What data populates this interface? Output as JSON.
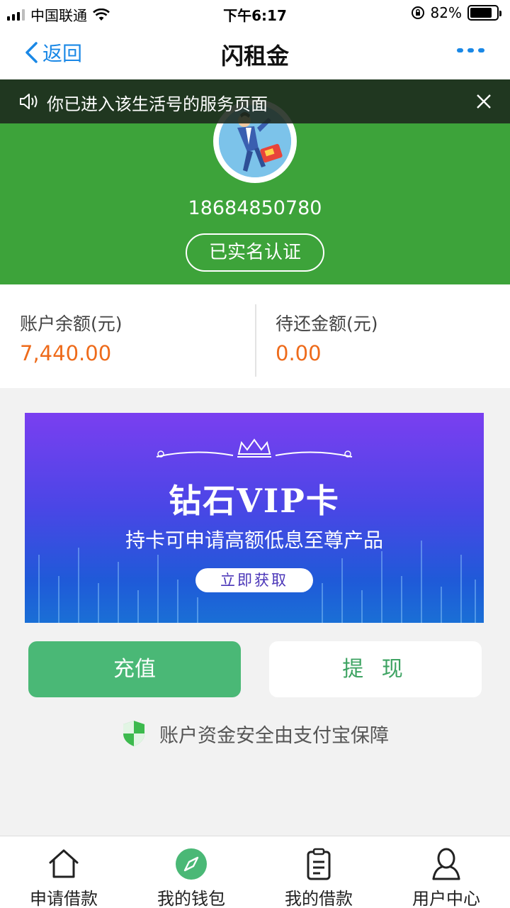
{
  "status_bar": {
    "carrier": "中国联通",
    "time": "下午6:17",
    "battery": "82%",
    "battery_level": 0.82
  },
  "nav": {
    "back_label": "返回",
    "title": "闪租金"
  },
  "notice": {
    "text": "你已进入该生活号的服务页面"
  },
  "profile": {
    "phone": "18684850780",
    "verified_label": "已实名认证"
  },
  "balances": {
    "account_label": "账户余额(元)",
    "account_value": "7,440.00",
    "due_label": "待还金额(元)",
    "due_value": "0.00"
  },
  "banner": {
    "title": "钻石VIP卡",
    "subtitle": "持卡可申请高额低息至尊产品",
    "cta": "立即获取"
  },
  "actions": {
    "recharge": "充值",
    "withdraw": "提 现"
  },
  "security_note": "账户资金安全由支付宝保障",
  "tabs": [
    {
      "label": "申请借款",
      "icon": "home-icon"
    },
    {
      "label": "我的钱包",
      "icon": "compass-icon",
      "active": true
    },
    {
      "label": "我的借款",
      "icon": "clipboard-icon"
    },
    {
      "label": "用户中心",
      "icon": "user-icon"
    }
  ],
  "colors": {
    "brand_green": "#3da33a",
    "link_blue": "#1a88e6",
    "amount_orange": "#ee6b1b",
    "button_green": "#4ab876"
  }
}
